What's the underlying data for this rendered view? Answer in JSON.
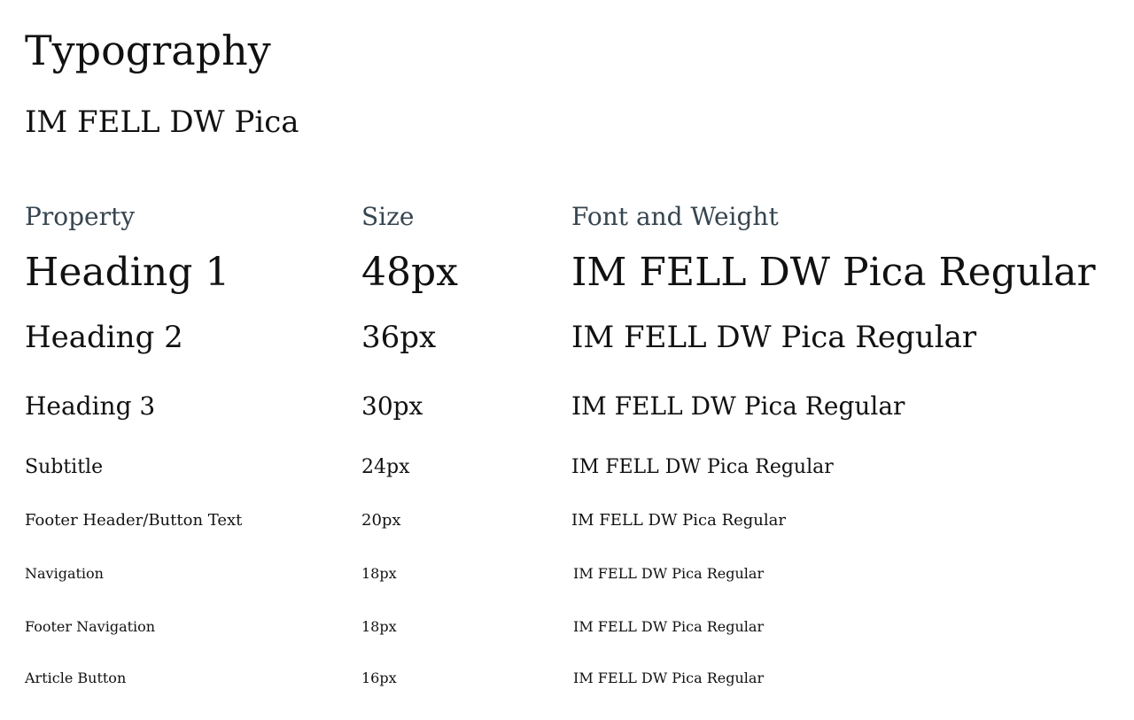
{
  "title": "Typography",
  "font_name": "IM FELL DW Pica",
  "table": {
    "headers": [
      "Property",
      "Size",
      "Font and Weight"
    ],
    "rows": [
      {
        "property": "Heading 1",
        "size": "48px",
        "font": "IM FELL DW Pica Regular"
      },
      {
        "property": "Heading 2",
        "size": "36px",
        "font": "IM FELL DW Pica Regular"
      },
      {
        "property": "Heading 3",
        "size": "30px",
        "font": "IM FELL DW Pica Regular"
      },
      {
        "property": "Subtitle",
        "size": "24px",
        "font": "IM FELL DW Pica Regular"
      },
      {
        "property": "Footer Header/Button Text",
        "size": "20px",
        "font": "IM FELL DW Pica Regular"
      },
      {
        "property": "Navigation",
        "size": "18px",
        "font": "IM FELL DW Pica Regular"
      },
      {
        "property": "Footer Navigation",
        "size": "18px",
        "font": "IM FELL DW Pica Regular"
      },
      {
        "property": "Article Button",
        "size": "16px",
        "font": "IM FELL DW Pica Regular"
      }
    ]
  },
  "colors": {
    "text": "#111111",
    "header_text": "#36454f",
    "background": "#ffffff"
  }
}
